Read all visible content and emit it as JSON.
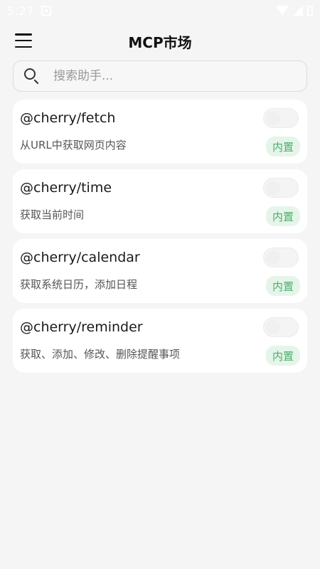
{
  "status_bar": {
    "time": "5:27",
    "icons": [
      "notification-icon",
      "wifi-icon",
      "signal-icon",
      "battery-icon"
    ]
  },
  "header": {
    "title": "MCP市场",
    "menu_icon": "menu-icon"
  },
  "search": {
    "placeholder": "搜索助手...",
    "value": "",
    "icon": "search-icon"
  },
  "servers": [
    {
      "name": "@cherry/fetch",
      "description": "从URL中获取网页内容",
      "badge": "内置",
      "enabled": false
    },
    {
      "name": "@cherry/time",
      "description": "获取当前时间",
      "badge": "内置",
      "enabled": false
    },
    {
      "name": "@cherry/calendar",
      "description": "获取系统日历，添加日程",
      "badge": "内置",
      "enabled": false
    },
    {
      "name": "@cherry/reminder",
      "description": "获取、添加、修改、删除提醒事项",
      "badge": "内置",
      "enabled": false
    }
  ],
  "colors": {
    "background": "#f5f5f5",
    "card": "#ffffff",
    "badge_bg": "#e6f5ea",
    "badge_text": "#4caf6a"
  }
}
